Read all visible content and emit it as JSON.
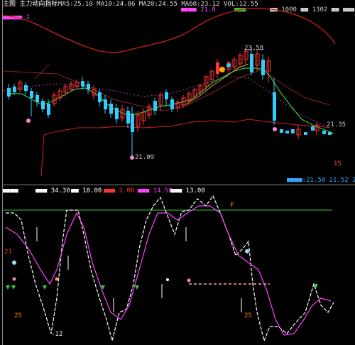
{
  "top_bar": {
    "main_label": "主图 主力动向指标",
    "values": "MA5:25.10  MA10:24.86  MA20:24.55  MA60:23.12  VOL:12.55",
    "cyan_tag": "■■■■",
    "magenta_tag": "■■■■ 21.8",
    "green_tag": "■■■",
    "white_tags": "■■ 1000 ■■ 1302 ■■ ■■■"
  },
  "sub_left_label": "■■■■■ 1",
  "price_labels": {
    "high": "23.58",
    "low_left": "21.09",
    "right_mid": "21.35",
    "right_low": "15"
  },
  "right_status": "■■■■:21.50  21.52  21.29",
  "indicator": {
    "label": "■■■■",
    "items": [
      {
        "text": "■■■ 34.30",
        "color": "#ffffff"
      },
      {
        "text": "■■ 18.00",
        "color": "#ffffff"
      },
      {
        "text": "■■■ 2.00",
        "color": "#ff3333"
      },
      {
        "text": "■■■ 14.50",
        "color": "#ff44ff"
      },
      {
        "text": "■■■ 13.00",
        "color": "#ffffff"
      }
    ],
    "level_label": "21",
    "bottom_left_label": "25",
    "bottom_mid_label": "25",
    "bottom_tag": "-12"
  },
  "colors": {
    "up": "#ff3333",
    "down": "#33ccff",
    "ma_green": "#33cc33",
    "ma_magenta": "#ff44ff",
    "band_red": "#cc2222",
    "k_white": "#ffffff"
  }
}
